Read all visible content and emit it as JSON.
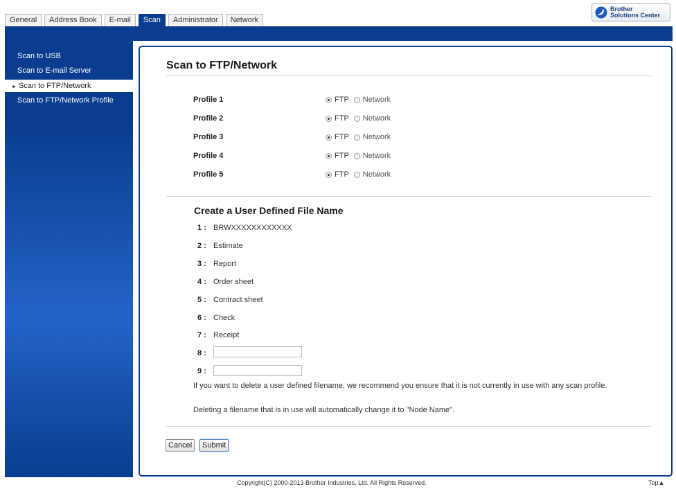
{
  "tabs": [
    {
      "label": "General"
    },
    {
      "label": "Address Book"
    },
    {
      "label": "E-mail"
    },
    {
      "label": "Scan"
    },
    {
      "label": "Administrator"
    },
    {
      "label": "Network"
    }
  ],
  "active_tab": "Scan",
  "logo": {
    "line1": "Brother",
    "line2": "Solutions Center",
    "icon": "brother-swoosh-icon"
  },
  "sidebar": {
    "items": [
      {
        "label": "Scan to USB"
      },
      {
        "label": "Scan to E-mail Server"
      },
      {
        "label": "Scan to FTP/Network"
      },
      {
        "label": "Scan to FTP/Network Profile"
      }
    ],
    "active": "Scan to FTP/Network"
  },
  "main": {
    "title": "Scan to FTP/Network",
    "profiles": [
      {
        "label": "Profile 1",
        "ftp_label": "FTP",
        "network_label": "Network",
        "selected": "FTP"
      },
      {
        "label": "Profile 2",
        "ftp_label": "FTP",
        "network_label": "Network",
        "selected": "FTP"
      },
      {
        "label": "Profile 3",
        "ftp_label": "FTP",
        "network_label": "Network",
        "selected": "FTP"
      },
      {
        "label": "Profile 4",
        "ftp_label": "FTP",
        "network_label": "Network",
        "selected": "FTP"
      },
      {
        "label": "Profile 5",
        "ftp_label": "FTP",
        "network_label": "Network",
        "selected": "FTP"
      }
    ],
    "filename_section": {
      "title": "Create a User Defined File Name",
      "entries": [
        {
          "num": "1 :",
          "value": "BRWXXXXXXXXXXXX"
        },
        {
          "num": "2 :",
          "value": "Estimate"
        },
        {
          "num": "3 :",
          "value": "Report"
        },
        {
          "num": "4 :",
          "value": "Order sheet"
        },
        {
          "num": "5 :",
          "value": "Contract sheet"
        },
        {
          "num": "6 :",
          "value": "Check"
        },
        {
          "num": "7 :",
          "value": "Receipt"
        },
        {
          "num": "8 :",
          "value": ""
        },
        {
          "num": "9 :",
          "value": ""
        }
      ]
    },
    "notes": [
      "If you want to delete a user defined filename, we recommend you ensure that it is not currently in use with any scan profile.",
      "Deleting a filename that is in use will automatically change it to \"Node Name\"."
    ],
    "buttons": {
      "cancel": "Cancel",
      "submit": "Submit"
    }
  },
  "footer": {
    "copyright": "Copyright(C) 2000-2013 Brother Industries, Ltd. All Rights Reserved.",
    "top_link": "Top▲"
  },
  "colors": {
    "header_blue": "#0a3d8f",
    "sidebar_highlight": "#2363c7"
  }
}
